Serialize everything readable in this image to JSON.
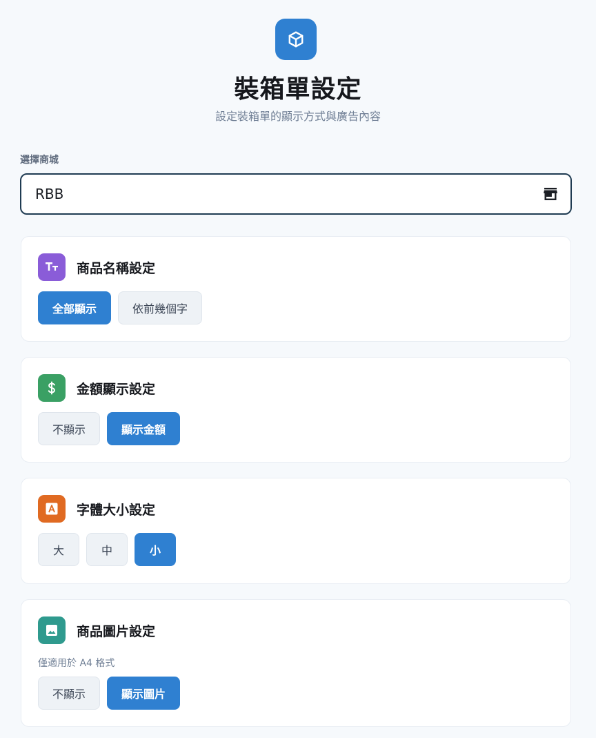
{
  "header": {
    "icon": "box-icon",
    "title": "裝箱單設定",
    "subtitle": "設定裝箱單的顯示方式與廣告內容",
    "accent_color": "#2f80d1"
  },
  "store": {
    "label": "選擇商城",
    "value": "RBB",
    "icon": "store-icon"
  },
  "sections": {
    "product_name": {
      "title": "商品名稱設定",
      "icon": "text-size-icon",
      "icon_color": "#8a5cd8",
      "options": [
        "全部顯示",
        "依前幾個字"
      ],
      "selected": "全部顯示"
    },
    "amount": {
      "title": "金額顯示設定",
      "icon": "dollar-icon",
      "icon_color": "#3aa064",
      "options": [
        "不顯示",
        "顯示金額"
      ],
      "selected": "顯示金額"
    },
    "font_size": {
      "title": "字體大小設定",
      "icon": "font-icon",
      "icon_color": "#e06a22",
      "options": [
        "大",
        "中",
        "小"
      ],
      "selected": "小"
    },
    "product_image": {
      "title": "商品圖片設定",
      "icon": "image-icon",
      "icon_color": "#2f9a8e",
      "note": "僅適用於 A4 格式",
      "options": [
        "不顯示",
        "顯示圖片"
      ],
      "selected": "顯示圖片"
    }
  }
}
